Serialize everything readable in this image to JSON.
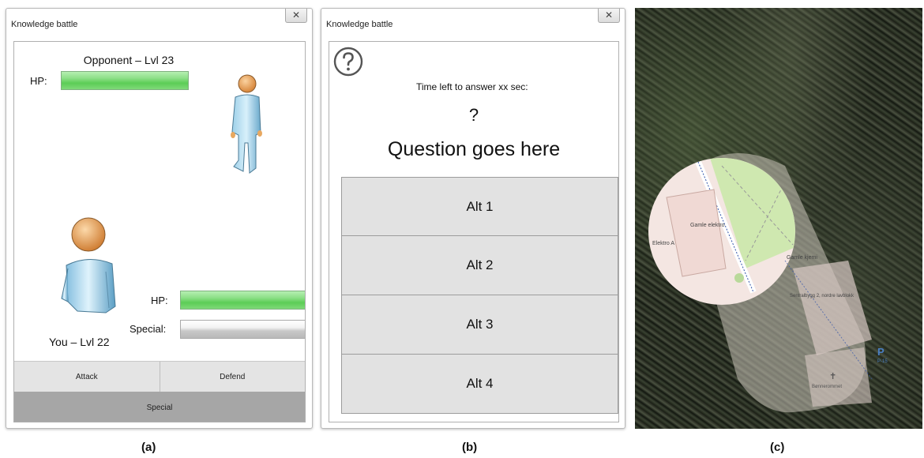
{
  "panels": {
    "a": {
      "label": "(a)",
      "window_title": "Knowledge battle",
      "close_glyph": "✕",
      "opponent": {
        "title": "Opponent – Lvl 23",
        "hp_label": "HP:",
        "hp_fraction": 1.0,
        "icon": "opponent-person-icon"
      },
      "player": {
        "title": "You – Lvl 22",
        "hp_label": "HP:",
        "hp_fraction": 1.0,
        "special_label": "Special:",
        "special_fraction": 1.0,
        "icon": "player-person-icon"
      },
      "buttons": {
        "attack": "Attack",
        "defend": "Defend",
        "special": "Special"
      }
    },
    "b": {
      "label": "(b)",
      "window_title": "Knowledge battle",
      "close_glyph": "✕",
      "help_icon": "question-circle-icon",
      "time_left": "Time left to answer xx sec:",
      "question_mark": "?",
      "question": "Question goes here",
      "alternatives": [
        "Alt 1",
        "Alt 2",
        "Alt 3",
        "Alt 4"
      ]
    },
    "c": {
      "label": "(c)",
      "map_labels": {
        "gamle_elektro": "Gamle elektro",
        "elektro_a": "Elektro A",
        "gamle_kjemi": "Gamle kjemi",
        "sentralbygg": "Sentralbygg 2, nordre lavblokk",
        "parking": "P",
        "parking_ref": "P-15",
        "bonnerommet": "Bønnerommet"
      }
    }
  },
  "colors": {
    "hp_green": "#5ccd56",
    "special_grey": "#c8c8c8",
    "button_bg": "#e4e4e4",
    "special_btn_bg": "#a6a6a6"
  }
}
